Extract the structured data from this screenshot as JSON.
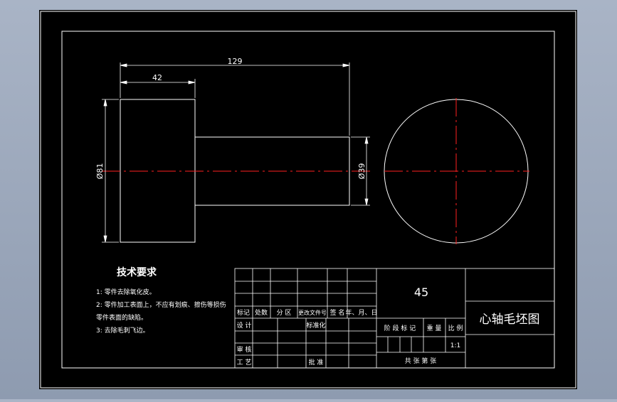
{
  "dimensions": {
    "overall_length": "129",
    "flange_length": "42",
    "large_diameter": "Ø81",
    "small_diameter": "Ø39"
  },
  "tech_requirements": {
    "title": "技术要求",
    "items": [
      "1: 零件去除氧化皮。",
      "2: 零件加工表面上，不应有划痕、擦伤等损伤",
      "零件表面的缺陷。",
      "3: 去除毛刺飞边。"
    ]
  },
  "title_block": {
    "material": "45",
    "drawing_name": "心轴毛坯图",
    "headers": [
      "标记",
      "处数",
      "分 区",
      "更改文件号",
      "签 名",
      "年、月、日"
    ],
    "row_design": "设 计",
    "row_standard": "标准化",
    "row_check": "审 核",
    "row_process": "工 艺",
    "row_approve": "批 准",
    "stage_mark": "阶 段 标 记",
    "weight": "重 量",
    "scale_label": "比 例",
    "scale_value": "1:1",
    "sheets": "共    张    第    张"
  },
  "colors": {
    "outline": "#ffffff",
    "centerline": "#ff2020",
    "background": "#000000"
  }
}
